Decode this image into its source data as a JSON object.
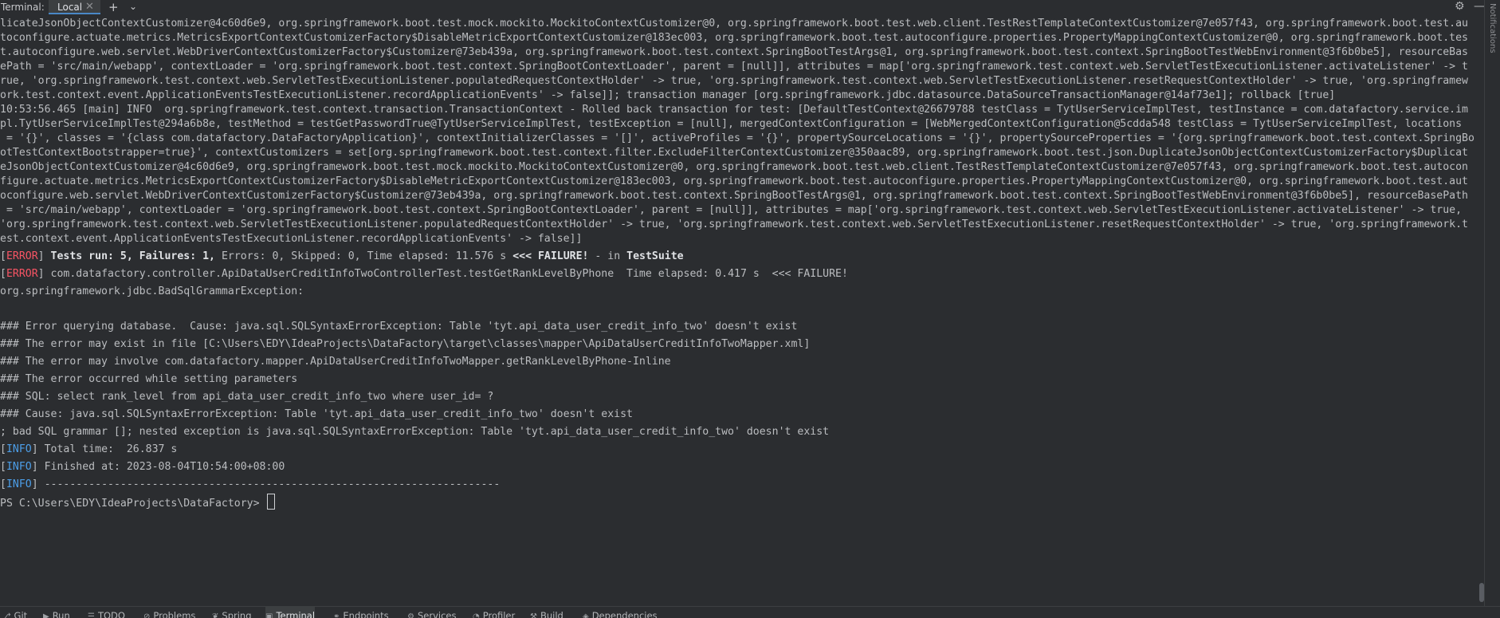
{
  "header": {
    "title": "Terminal:",
    "tab_label": "Local",
    "tab_close": "✕",
    "new_tab": "+",
    "dropdown": "⌄",
    "settings_icon": "⚙",
    "minimize_icon": "—"
  },
  "right_strip": {
    "label": "Notifications"
  },
  "terminal": {
    "lines": [
      "licateJsonObjectContextCustomizer@4c60d6e9, org.springframework.boot.test.mock.mockito.MockitoContextCustomizer@0, org.springframework.boot.test.web.client.TestRestTemplateContextCustomizer@7e057f43, org.springframework.boot.test.au",
      "toconfigure.actuate.metrics.MetricsExportContextCustomizerFactory$DisableMetricExportContextCustomizer@183ec003, org.springframework.boot.test.autoconfigure.properties.PropertyMappingContextCustomizer@0, org.springframework.boot.tes",
      "t.autoconfigure.web.servlet.WebDriverContextCustomizerFactory$Customizer@73eb439a, org.springframework.boot.test.context.SpringBootTestArgs@1, org.springframework.boot.test.context.SpringBootTestWebEnvironment@3f6b0be5], resourceBas",
      "ePath = 'src/main/webapp', contextLoader = 'org.springframework.boot.test.context.SpringBootContextLoader', parent = [null]], attributes = map['org.springframework.test.context.web.ServletTestExecutionListener.activateListener' -> t",
      "rue, 'org.springframework.test.context.web.ServletTestExecutionListener.populatedRequestContextHolder' -> true, 'org.springframework.test.context.web.ServletTestExecutionListener.resetRequestContextHolder' -> true, 'org.springframew",
      "ork.test.context.event.ApplicationEventsTestExecutionListener.recordApplicationEvents' -> false]]; transaction manager [org.springframework.jdbc.datasource.DataSourceTransactionManager@14af73e1]; rollback [true]",
      "10:53:56.465 [main] INFO  org.springframework.test.context.transaction.TransactionContext - Rolled back transaction for test: [DefaultTestContext@26679788 testClass = TytUserServiceImplTest, testInstance = com.datafactory.service.im",
      "pl.TytUserServiceImplTest@294a6b8e, testMethod = testGetPasswordTrue@TytUserServiceImplTest, testException = [null], mergedContextConfiguration = [WebMergedContextConfiguration@5cdda548 testClass = TytUserServiceImplTest, locations",
      " = '{}', classes = '{class com.datafactory.DataFactoryApplication}', contextInitializerClasses = '[]', activeProfiles = '{}', propertySourceLocations = '{}', propertySourceProperties = '{org.springframework.boot.test.context.SpringBo",
      "otTestContextBootstrapper=true}', contextCustomizers = set[org.springframework.boot.test.context.filter.ExcludeFilterContextCustomizer@350aac89, org.springframework.boot.test.json.DuplicateJsonObjectContextCustomizerFactory$Duplicat",
      "eJsonObjectContextCustomizer@4c60d6e9, org.springframework.boot.test.mock.mockito.MockitoContextCustomizer@0, org.springframework.boot.test.web.client.TestRestTemplateContextCustomizer@7e057f43, org.springframework.boot.test.autocon",
      "figure.actuate.metrics.MetricsExportContextCustomizerFactory$DisableMetricExportContextCustomizer@183ec003, org.springframework.boot.test.autoconfigure.properties.PropertyMappingContextCustomizer@0, org.springframework.boot.test.aut",
      "oconfigure.web.servlet.WebDriverContextCustomizerFactory$Customizer@73eb439a, org.springframework.boot.test.context.SpringBootTestArgs@1, org.springframework.boot.test.context.SpringBootTestWebEnvironment@3f6b0be5], resourceBasePath",
      " = 'src/main/webapp', contextLoader = 'org.springframework.boot.test.context.SpringBootContextLoader', parent = [null]], attributes = map['org.springframework.test.context.web.ServletTestExecutionListener.activateListener' -> true,",
      "'org.springframework.test.context.web.ServletTestExecutionListener.populatedRequestContextHolder' -> true, 'org.springframework.test.context.web.ServletTestExecutionListener.resetRequestContextHolder' -> true, 'org.springframework.t",
      "est.context.event.ApplicationEventsTestExecutionListener.recordApplicationEvents' -> false]]"
    ],
    "summary": {
      "tag": "ERROR",
      "tests_run_label": "Tests run: 5,",
      "failures_label": "Failures: 1,",
      "rest": "Errors: 0, Skipped: 0, Time elapsed: 11.576 s",
      "failure_marker": "<<< FAILURE!",
      "in_label": "- in",
      "suite": "TestSuite"
    },
    "failure_line": {
      "tag": "ERROR",
      "text": "com.datafactory.controller.ApiDataUserCreditInfoTwoControllerTest.testGetRankLevelByPhone  Time elapsed: 0.417 s  <<< FAILURE!"
    },
    "exception": "org.springframework.jdbc.BadSqlGrammarException:",
    "error_lines": [
      "### Error querying database.  Cause: java.sql.SQLSyntaxErrorException: Table 'tyt.api_data_user_credit_info_two' doesn't exist",
      "### The error may exist in file [C:\\Users\\EDY\\IdeaProjects\\DataFactory\\target\\classes\\mapper\\ApiDataUserCreditInfoTwoMapper.xml]",
      "### The error may involve com.datafactory.mapper.ApiDataUserCreditInfoTwoMapper.getRankLevelByPhone-Inline",
      "### The error occurred while setting parameters",
      "### SQL: select rank_level from api_data_user_credit_info_two where user_id= ?",
      "### Cause: java.sql.SQLSyntaxErrorException: Table 'tyt.api_data_user_credit_info_two' doesn't exist",
      "; bad SQL grammar []; nested exception is java.sql.SQLSyntaxErrorException: Table 'tyt.api_data_user_credit_info_two' doesn't exist"
    ],
    "info_lines": [
      {
        "tag": "INFO",
        "text": "Total time:  26.837 s"
      },
      {
        "tag": "INFO",
        "text": "Finished at: 2023-08-04T10:54:00+08:00"
      },
      {
        "tag": "INFO",
        "text": "------------------------------------------------------------------------"
      }
    ],
    "prompt": "PS C:\\Users\\EDY\\IdeaProjects\\DataFactory>"
  },
  "statusbar": {
    "items": [
      {
        "label": "Git",
        "icon": "⎇"
      },
      {
        "label": "Run",
        "icon": "▶"
      },
      {
        "label": "TODO",
        "icon": "☰"
      },
      {
        "label": "Problems",
        "icon": "⊘"
      },
      {
        "label": "Spring",
        "icon": "❦"
      },
      {
        "label": "Terminal",
        "icon": "▣"
      },
      {
        "label": "Endpoints",
        "icon": "⚭"
      },
      {
        "label": "Services",
        "icon": "⚙"
      },
      {
        "label": "Profiler",
        "icon": "◔"
      },
      {
        "label": "Build",
        "icon": "⚒"
      },
      {
        "label": "Dependencies",
        "icon": "◈"
      }
    ]
  },
  "colors": {
    "background": "#2b2d30",
    "text": "#bbbdc0",
    "error": "#f75464",
    "info": "#4c9ee8",
    "tab_underline": "#4a88c7"
  }
}
